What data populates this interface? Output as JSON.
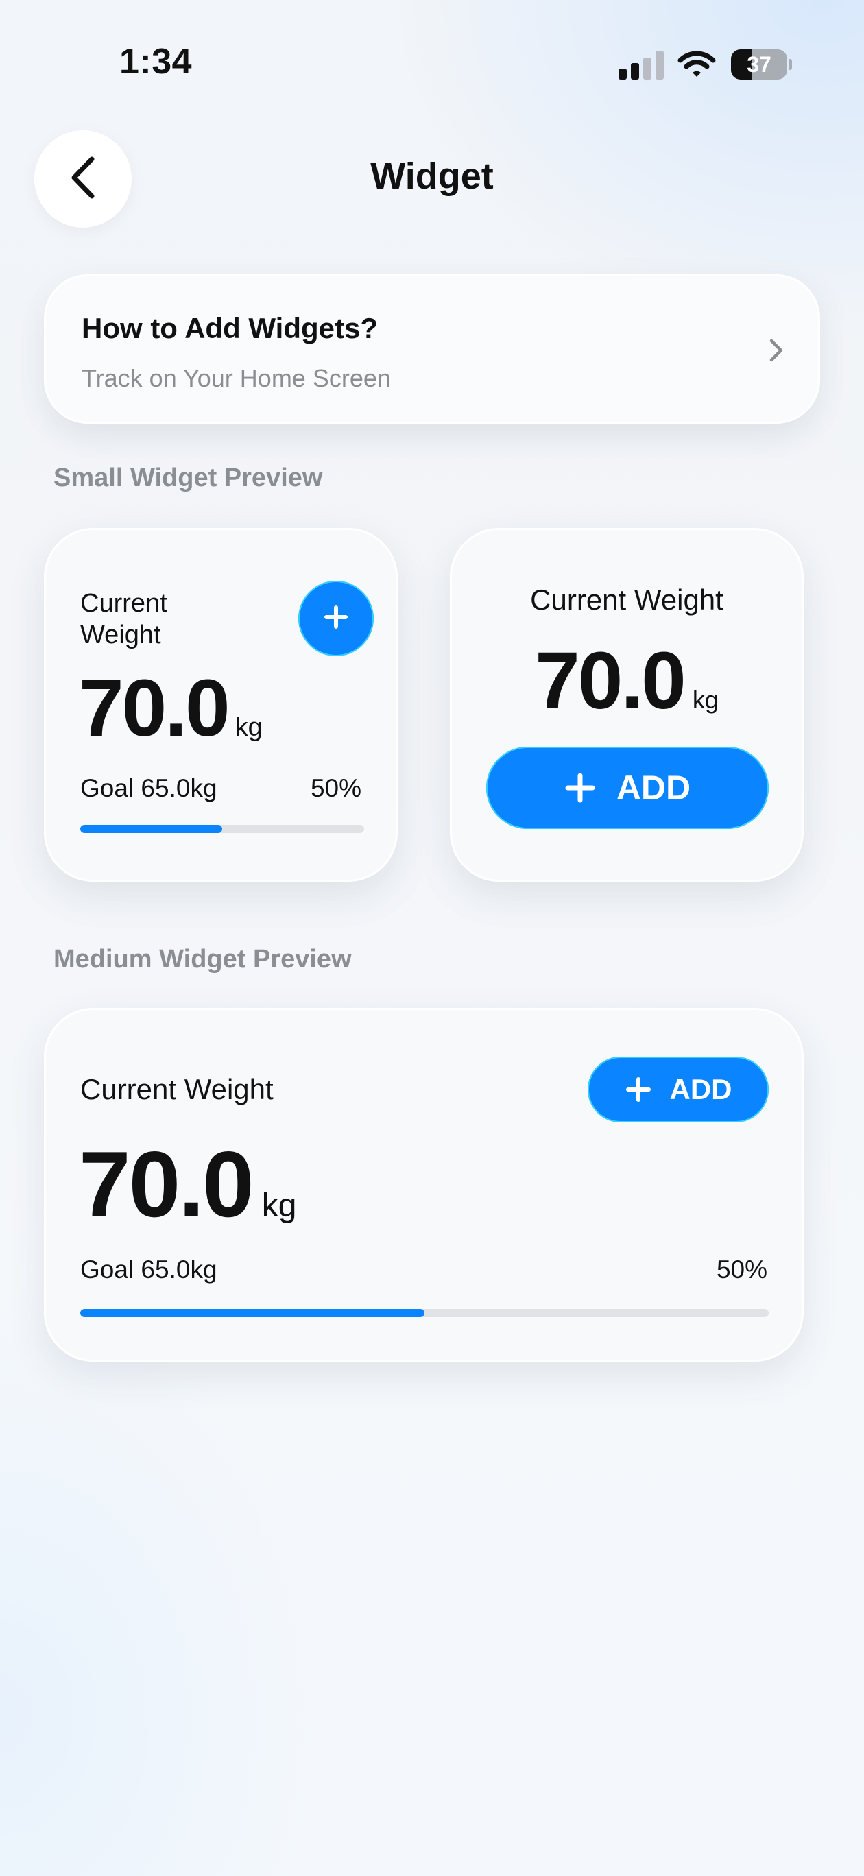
{
  "status_bar": {
    "time": "1:34",
    "battery": "37",
    "battery_level": 0.37
  },
  "header": {
    "title": "Widget"
  },
  "howto": {
    "title": "How to Add Widgets?",
    "subtitle": "Track on Your Home Screen"
  },
  "sections": {
    "small": "Small Widget Preview",
    "medium": "Medium Widget Preview"
  },
  "small_widget_1": {
    "label_line1": "Current",
    "label_line2": "Weight",
    "value": "70.0",
    "unit": "kg",
    "goal": "Goal 65.0kg",
    "percent": "50%",
    "progress": 0.5
  },
  "small_widget_2": {
    "label": "Current Weight",
    "value": "70.0",
    "unit": "kg",
    "add_label": "ADD"
  },
  "medium_widget": {
    "label": "Current Weight",
    "value": "70.0",
    "unit": "kg",
    "add_label": "ADD",
    "goal": "Goal 65.0kg",
    "percent": "50%",
    "progress": 0.5
  },
  "colors": {
    "accent": "#0a84ff",
    "track": "#e1e2e5",
    "muted_text": "#8a8d92"
  },
  "icons": [
    "back-chevron-icon",
    "chevron-right-icon",
    "plus-icon",
    "signal-icon",
    "wifi-icon",
    "battery-icon"
  ]
}
